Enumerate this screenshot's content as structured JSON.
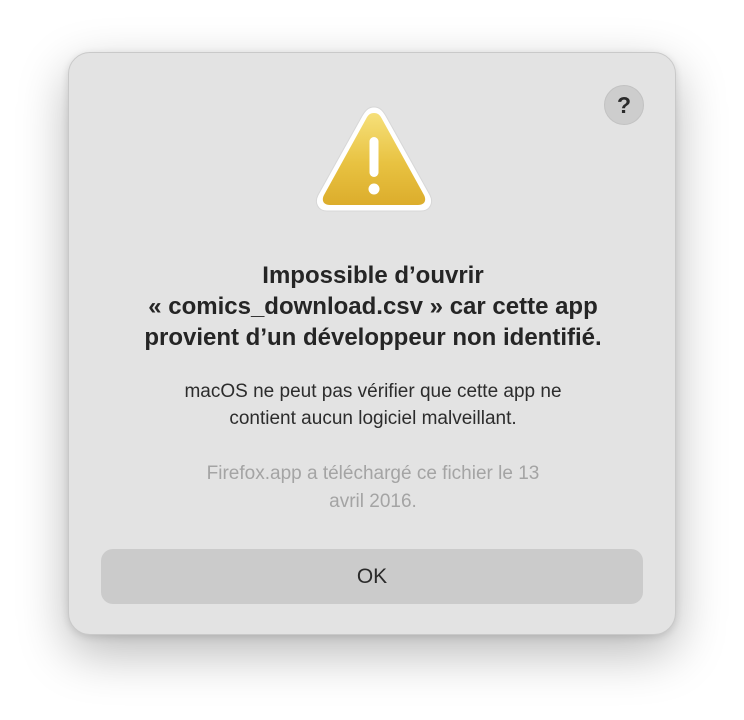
{
  "dialog": {
    "help_label": "?",
    "icon": "warning-icon",
    "title_line1": "Impossible d’ouvrir",
    "title_line2": "« comics_download.csv » car cette app",
    "title_line3": "provient d’un développeur non identifié.",
    "message_line1": "macOS ne peut pas vérifier que cette app ne",
    "message_line2": "contient aucun logiciel malveillant.",
    "info_line1": "Firefox.app a téléchargé ce fichier le 13",
    "info_line2": "avril 2016.",
    "ok_label": "OK"
  },
  "colors": {
    "dialog_background": "#e3e3e3",
    "warning_yellow": "#e9c23e",
    "button_background": "#cbcbcb",
    "secondary_text": "#a4a4a4"
  }
}
